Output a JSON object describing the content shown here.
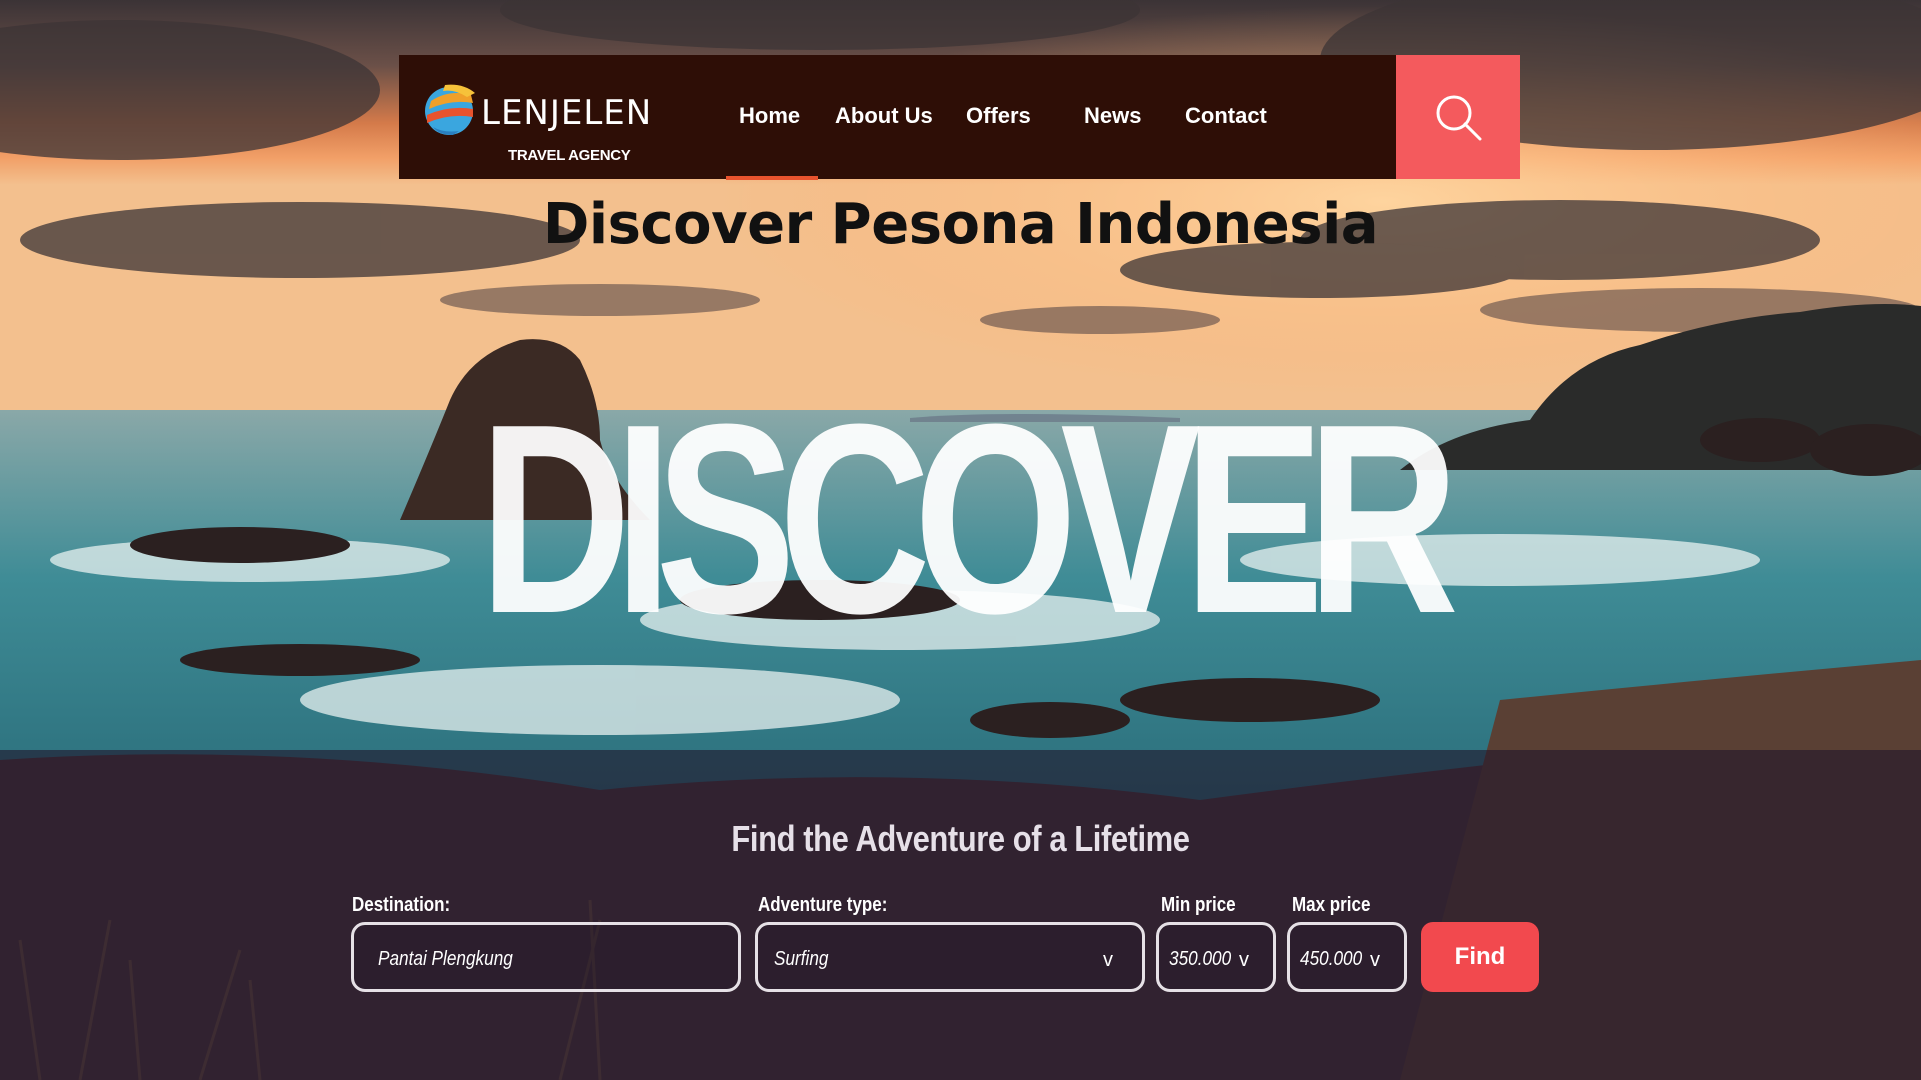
{
  "brand": {
    "name": "LENJELEN",
    "subtitle": "TRAVEL AGENCY",
    "logo_icon": "globe-icon"
  },
  "nav": {
    "items": [
      {
        "label": "Home",
        "active": true
      },
      {
        "label": "About Us",
        "active": false
      },
      {
        "label": "Offers",
        "active": false
      },
      {
        "label": "News",
        "active": false
      },
      {
        "label": "Contact",
        "active": false
      }
    ],
    "search_icon": "search-icon"
  },
  "hero": {
    "title": "Discover Pesona Indonesia",
    "big_word": "DISCOVER"
  },
  "search": {
    "tagline": "Find the Adventure of a Lifetime",
    "destination": {
      "label": "Destination:",
      "value": "Pantai Plengkung"
    },
    "adventure_type": {
      "label": "Adventure type:",
      "value": "Surfing",
      "chevron": "v"
    },
    "min_price": {
      "label": "Min price",
      "value": "350.000",
      "chevron": "v"
    },
    "max_price": {
      "label": "Max price",
      "value": "450.000",
      "chevron": "v"
    },
    "find_label": "Find"
  },
  "colors": {
    "nav_bg": "#2e0e06",
    "accent": "#f45a5d",
    "active_underline": "#e8532e",
    "find_button": "#f2494e"
  }
}
